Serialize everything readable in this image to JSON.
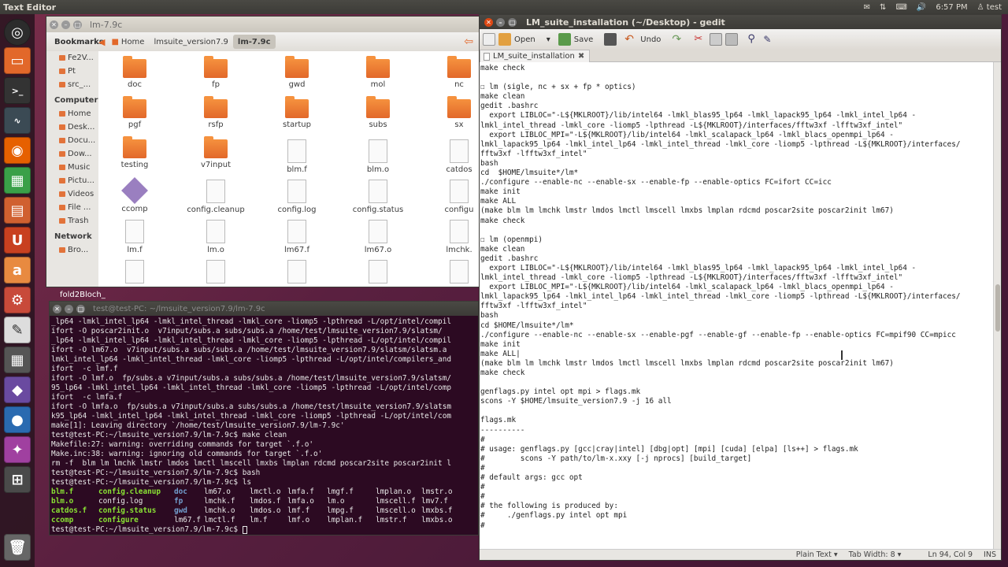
{
  "top_panel": {
    "app_title": "Text Editor",
    "time": "6:57 PM",
    "user": "test"
  },
  "file_manager": {
    "title": "lm-7.9c",
    "breadcrumbs": [
      "Home",
      "lmsuite_version7.9",
      "lm-7.9c"
    ],
    "sidebar": {
      "bookmarks_head": "Bookmarks",
      "bookmarks": [
        "Fe2V...",
        "Pt",
        "src_..."
      ],
      "computer_head": "Computer",
      "computer": [
        "Home",
        "Desk...",
        "Docu...",
        "Dow...",
        "Music",
        "Pictu...",
        "Videos",
        "File ...",
        "Trash"
      ],
      "network_head": "Network",
      "network": [
        "Bro..."
      ]
    },
    "items": [
      {
        "label": "doc",
        "kind": "folder"
      },
      {
        "label": "fp",
        "kind": "folder"
      },
      {
        "label": "gwd",
        "kind": "folder"
      },
      {
        "label": "mol",
        "kind": "folder"
      },
      {
        "label": "nc",
        "kind": "folder"
      },
      {
        "label": "pgf",
        "kind": "folder"
      },
      {
        "label": "rsfp",
        "kind": "folder"
      },
      {
        "label": "startup",
        "kind": "folder"
      },
      {
        "label": "subs",
        "kind": "folder"
      },
      {
        "label": "sx",
        "kind": "folder"
      },
      {
        "label": "testing",
        "kind": "folder"
      },
      {
        "label": "v7input",
        "kind": "folder"
      },
      {
        "label": "blm.f",
        "kind": "doc"
      },
      {
        "label": "blm.o",
        "kind": "doc"
      },
      {
        "label": "catdos",
        "kind": "doc"
      },
      {
        "label": "ccomp",
        "kind": "diamond"
      },
      {
        "label": "config.cleanup",
        "kind": "doc"
      },
      {
        "label": "config.log",
        "kind": "doc"
      },
      {
        "label": "config.status",
        "kind": "doc"
      },
      {
        "label": "configu",
        "kind": "doc"
      },
      {
        "label": "lm.f",
        "kind": "doc"
      },
      {
        "label": "lm.o",
        "kind": "doc"
      },
      {
        "label": "lm67.f",
        "kind": "doc"
      },
      {
        "label": "lm67.o",
        "kind": "doc"
      },
      {
        "label": "lmchk.",
        "kind": "doc"
      },
      {
        "label": "",
        "kind": "doc"
      },
      {
        "label": "",
        "kind": "doc"
      },
      {
        "label": "",
        "kind": "doc"
      },
      {
        "label": "",
        "kind": "doc"
      },
      {
        "label": "",
        "kind": "doc"
      }
    ],
    "desktop_label": "fold2Bloch_"
  },
  "terminal": {
    "title": "test@test-PC: ~/lmsuite_version7.9/lm-7.9c",
    "lines": [
      "_lp64 -lmkl_intel_lp64 -lmkl_intel_thread -lmkl_core -liomp5 -lpthread -L/opt/intel/compil",
      "ifort -O poscar2init.o  v7input/subs.a subs/subs.a /home/test/lmsuite_version7.9/slatsm/",
      "_lp64 -lmkl_intel_lp64 -lmkl_intel_thread -lmkl_core -liomp5 -lpthread -L/opt/intel/compil",
      "ifort -O lm67.o  v7input/subs.a subs/subs.a /home/test/lmsuite_version7.9/slatsm/slatsm.a",
      "lmkl_intel_lp64 -lmkl_intel_thread -lmkl_core -liomp5 -lpthread -L/opt/intel/compilers_and",
      "ifort  -c lmf.f",
      "ifort -O lmf.o  fp/subs.a v7input/subs.a subs/subs.a /home/test/lmsuite_version7.9/slatsm/",
      "95_lp64 -lmkl_intel_lp64 -lmkl_intel_thread -lmkl_core -liomp5 -lpthread -L/opt/intel/comp",
      "ifort  -c lmfa.f",
      "ifort -O lmfa.o  fp/subs.a v7input/subs.a subs/subs.a /home/test/lmsuite_version7.9/slatsm",
      "k95_lp64 -lmkl_intel_lp64 -lmkl_intel_thread -lmkl_core -liomp5 -lpthread -L/opt/intel/com",
      "make[1]: Leaving directory `/home/test/lmsuite_version7.9/lm-7.9c'",
      "test@test-PC:~/lmsuite_version7.9/lm-7.9c$ make clean",
      "Makefile:27: warning: overriding commands for target `.f.o'",
      "Make.inc:38: warning: ignoring old commands for target `.f.o'",
      "rm -f  blm lm lmchk lmstr lmdos lmctl lmscell lmxbs lmplan rdcmd poscar2site poscar2init l",
      "test@test-PC:~/lmsuite_version7.9/lm-7.9c$ bash",
      "test@test-PC:~/lmsuite_version7.9/lm-7.9c$ ls"
    ],
    "ls_rows": [
      [
        "blm.f",
        "config.cleanup",
        "doc",
        "lm67.o",
        "lmctl.o",
        "lmfa.f",
        "lmgf.f",
        "lmplan.o",
        "lmstr.o"
      ],
      [
        "blm.o",
        "config.log",
        "fp",
        "lmchk.f",
        "lmdos.f",
        "lmfa.o",
        "lm.o",
        "lmscell.f",
        "lmv7.f"
      ],
      [
        "catdos.f",
        "config.status",
        "gwd",
        "lmchk.o",
        "lmdos.o",
        "lmf.f",
        "lmpg.f",
        "lmscell.o",
        "lmxbs.f"
      ],
      [
        "ccomp",
        "configure",
        "lm67.f",
        "lmctl.f",
        "lm.f",
        "lmf.o",
        "lmplan.f",
        "lmstr.f",
        "lmxbs.o"
      ]
    ],
    "prompt": "test@test-PC:~/lmsuite_version7.9/lm-7.9c$ "
  },
  "gedit": {
    "title": "LM_suite_installation (~/Desktop) - gedit",
    "toolbar": {
      "open": "Open",
      "save": "Save",
      "undo": "Undo"
    },
    "tab_label": "LM_suite_installation",
    "lines": [
      "make check",
      "",
      "☐ lm (sigle, nc + sx + fp * optics)",
      "make clean",
      "gedit .bashrc",
      "  export LIBLOC=\"-L${MKLROOT}/lib/intel64 -lmkl_blas95_lp64 -lmkl_lapack95_lp64 -lmkl_intel_lp64 -",
      "lmkl_intel_thread -lmkl_core -liomp5 -lpthread -L${MKLROOT}/interfaces/fftw3xf -lfftw3xf_intel\"",
      "  export LIBLOC_MPI=\"-L${MKLROOT}/lib/intel64 -lmkl_scalapack_lp64 -lmkl_blacs_openmpi_lp64 -",
      "lmkl_lapack95_lp64 -lmkl_intel_lp64 -lmkl_intel_thread -lmkl_core -liomp5 -lpthread -L${MKLROOT}/interfaces/",
      "fftw3xf -lfftw3xf_intel\"",
      "bash",
      "cd  $HOME/lmsuite*/lm*",
      "./configure --enable-nc --enable-sx --enable-fp --enable-optics FC=ifort CC=icc",
      "make init",
      "make ALL",
      "(make blm lm lmchk lmstr lmdos lmctl lmscell lmxbs lmplan rdcmd poscar2site poscar2init lm67)",
      "make check",
      "",
      "☐ lm (openmpi)",
      "make clean",
      "gedit .bashrc",
      "  export LIBLOC=\"-L${MKLROOT}/lib/intel64 -lmkl_blas95_lp64 -lmkl_lapack95_lp64 -lmkl_intel_lp64 -",
      "lmkl_intel_thread -lmkl_core -liomp5 -lpthread -L${MKLROOT}/interfaces/fftw3xf -lfftw3xf_intel\"",
      "  export LIBLOC_MPI=\"-L${MKLROOT}/lib/intel64 -lmkl_scalapack_lp64 -lmkl_blacs_openmpi_lp64 -",
      "lmkl_lapack95_lp64 -lmkl_intel_lp64 -lmkl_intel_thread -lmkl_core -liomp5 -lpthread -L${MKLROOT}/interfaces/",
      "fftw3xf -lfftw3xf_intel\"",
      "bash",
      "cd $HOME/lmsuite*/lm*",
      "./configure --enable-nc --enable-sx --enable-pgf --enable-gf --enable-fp --enable-optics FC=mpif90 CC=mpicc",
      "make init",
      "make ALL|",
      "(make blm lm lmchk lmstr lmdos lmctl lmscell lmxbs lmplan rdcmd poscar2site poscar2init lm67)",
      "make check",
      "",
      "genflags.py intel opt mpi > flags.mk",
      "scons -Y $HOME/lmsuite_version7.9 -j 16 all",
      "",
      "flags.mk",
      "----------",
      "#",
      "# usage: genflags.py [gcc|cray|intel] [dbg|opt] [mpi] [cuda] [elpa] [ls++] > flags.mk",
      "#        scons -Y path/to/lm-x.xxy [-j nprocs] [build_target]",
      "#",
      "# default args: gcc opt",
      "#",
      "#",
      "# the following is produced by:",
      "#     ./genflags.py intel opt mpi",
      "#"
    ],
    "status": {
      "language": "Plain Text ▾",
      "tab_width": "Tab Width: 8 ▾",
      "position": "Ln 94, Col 9",
      "mode": "INS"
    }
  },
  "colors": {
    "accent": "#dd4814",
    "terminal_bg": "#2c0a22",
    "ls_dir": "#729fcf",
    "ls_exec": "#8ae234"
  }
}
